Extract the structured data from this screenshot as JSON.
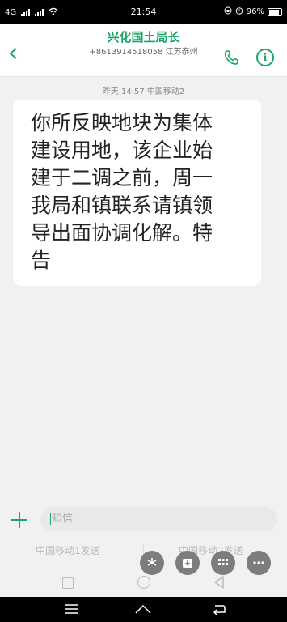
{
  "status_bar": {
    "network": "4G",
    "time": "21:54",
    "battery_percent": "96%"
  },
  "header": {
    "contact_name": "兴化国土局长",
    "contact_number_location": "+8613914518058  江苏泰州",
    "icons": [
      "back-arrow-icon",
      "phone-icon",
      "info-icon"
    ],
    "accent_color": "#1aa567"
  },
  "conversation": {
    "timestamp": "昨天 14:57  中国移动2",
    "messages": [
      {
        "text": "你所反映地块为集体\n建设用地，该企业始\n建于二调之前，周一\n我局和镇联系请镇领\n导出面协调化解。特\n告"
      }
    ]
  },
  "compose": {
    "placeholder": "短信",
    "send_sim1_label": "中国移动1发送",
    "send_sim2_label": "中国移动2发送"
  },
  "floating_buttons": [
    "pinwheel-icon",
    "download-icon",
    "grid-icon",
    "more-icon"
  ]
}
